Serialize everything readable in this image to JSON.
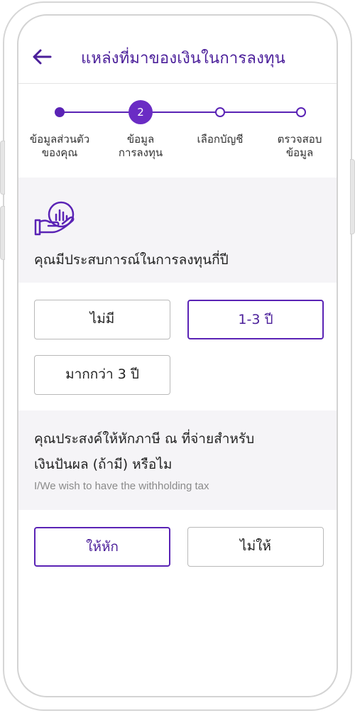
{
  "header": {
    "title": "แหล่งที่มาของเงินในการลงทุน"
  },
  "stepper": {
    "current_step": 2,
    "current_step_label": "2",
    "steps": [
      {
        "label": "ข้อมูลส่วนตัว\nของคุณ",
        "state": "done"
      },
      {
        "label": "ข้อมูล\nการลงทุน",
        "state": "current"
      },
      {
        "label": "เลือกบัญชี",
        "state": "todo"
      },
      {
        "label": "ตรวจสอบ\nข้อมูล",
        "state": "todo"
      }
    ]
  },
  "experience": {
    "question": "คุณมีประสบการณ์ในการลงทุนกี่ปี",
    "icon": "hand-chart-icon",
    "options": [
      {
        "label": "ไม่มี",
        "selected": false
      },
      {
        "label": "1-3 ปี",
        "selected": true
      },
      {
        "label": "มากกว่า 3 ปี",
        "selected": false
      }
    ]
  },
  "withholding": {
    "question_line1": "คุณประสงค์ให้หักภาษี ณ ที่จ่ายสำหรับ",
    "question_line2": "เงินปันผล (ถ้ามี) หรือไม",
    "subtitle": "I/We wish to have the withholding tax",
    "options": [
      {
        "label": "ให้หัก",
        "selected": true
      },
      {
        "label": "ไม่ให้",
        "selected": false
      }
    ]
  },
  "colors": {
    "accent": "#5a23b5",
    "title": "#4b1f9a",
    "panel": "#f5f4f7",
    "border": "#b9b9b9"
  }
}
